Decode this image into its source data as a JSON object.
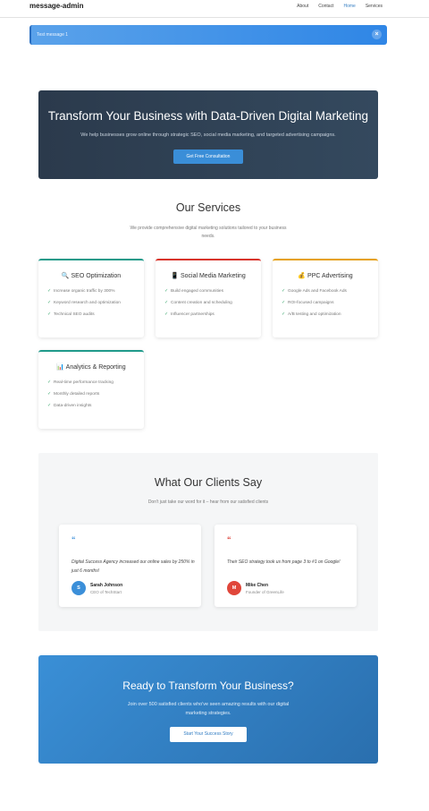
{
  "header": {
    "brand": "message-admin",
    "nav": [
      "About",
      "Contact",
      "Home",
      "Services"
    ]
  },
  "toast": {
    "message": "Test message 1",
    "close_glyph": "×"
  },
  "hero": {
    "title": "Transform Your Business with Data-Driven Digital Marketing",
    "subtitle": "We help businesses grow online through strategic SEO, social media marketing, and targeted advertising campaigns.",
    "button": "Get Free Consultation"
  },
  "services": {
    "title": "Our Services",
    "subtitle": "We provide comprehensive digital marketing solutions tailored to your business needs.",
    "cards": [
      {
        "icon": "🔍",
        "title": "SEO Optimization",
        "accent": "#1f9a8a",
        "items": [
          "Increase organic traffic by 300%",
          "Keyword research and optimization",
          "Technical SEO audits"
        ]
      },
      {
        "icon": "📱",
        "title": "Social Media Marketing",
        "accent": "#d9342b",
        "items": [
          "Build engaged communities",
          "Content creation and scheduling",
          "Influencer partnerships"
        ]
      },
      {
        "icon": "💰",
        "title": "PPC Advertising",
        "accent": "#e6a117",
        "items": [
          "Google Ads and Facebook Ads",
          "ROI-focused campaigns",
          "A/B testing and optimization"
        ]
      },
      {
        "icon": "📊",
        "title": "Analytics & Reporting",
        "accent": "#1f9a8a",
        "items": [
          "Real-time performance tracking",
          "Monthly detailed reports",
          "Data-driven insights"
        ]
      }
    ]
  },
  "testimonials": {
    "title": "What Our Clients Say",
    "subtitle": "Don't just take our word for it – hear from our satisfied clients",
    "items": [
      {
        "quote_mark": "“",
        "quote_color": "#3b8fd9",
        "text": "Digital Success Agency increased our online sales by 250% in just 6 months!",
        "initial": "S",
        "avatar_color": "#3b8fd9",
        "name": "Sarah Johnson",
        "role": "CEO of TechStart"
      },
      {
        "quote_mark": "“",
        "quote_color": "#d9342b",
        "text": "Their SEO strategy took us from page 3 to #1 on Google!",
        "initial": "M",
        "avatar_color": "#e0463a",
        "name": "Mike Chen",
        "role": "Founder of GreenLife"
      }
    ]
  },
  "cta": {
    "title": "Ready to Transform Your Business?",
    "subtitle": "Join over 500 satisfied clients who've seen amazing results with our digital marketing strategies.",
    "button": "Start Your Success Story"
  }
}
